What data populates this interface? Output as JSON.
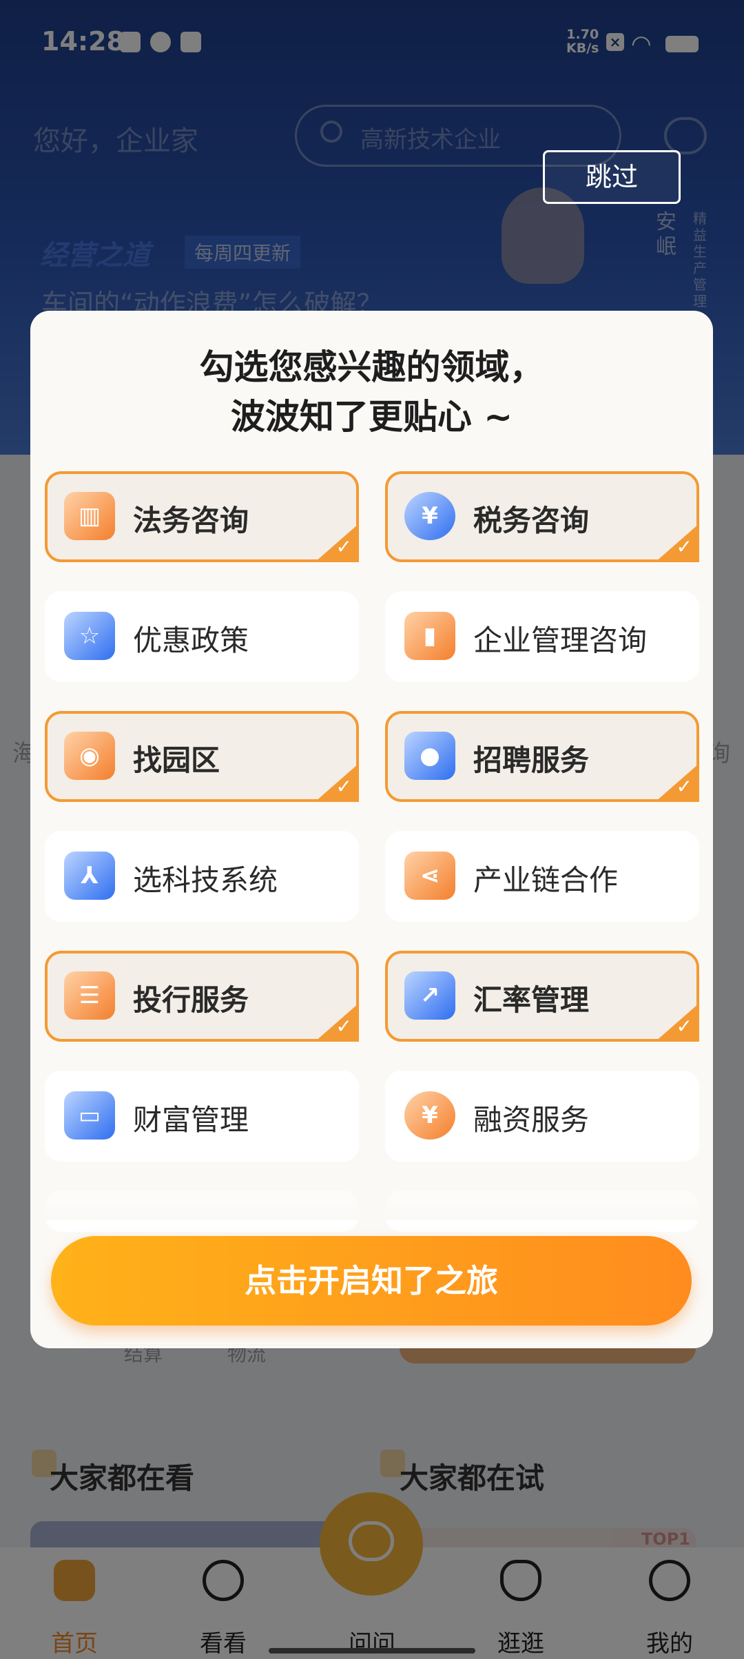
{
  "status_bar": {
    "time": "14:28",
    "speed": "1.70",
    "speed_unit": "KB/s"
  },
  "header": {
    "greeting": "您好，企业家",
    "search_placeholder": "高新技术企业",
    "skip_label": "跳过"
  },
  "banner": {
    "brand": "经营之道",
    "tag": "每周四更新",
    "title": "车间的“动作浪费”怎么破解？",
    "person_name": "安岷",
    "person_role": "精益生产管理"
  },
  "modal": {
    "title_line1": "勾选您感兴趣的领域，",
    "title_line2": "波波知了更贴心 ~",
    "options": [
      {
        "label": "法务咨询",
        "selected": true,
        "icon": "courthouse-icon",
        "color": "orange"
      },
      {
        "label": "税务咨询",
        "selected": true,
        "icon": "yuan-coin-icon",
        "color": "blue"
      },
      {
        "label": "优惠政策",
        "selected": false,
        "icon": "policy-document-icon",
        "color": "blue"
      },
      {
        "label": "企业管理咨询",
        "selected": false,
        "icon": "monitor-chart-icon",
        "color": "orange"
      },
      {
        "label": "找园区",
        "selected": true,
        "icon": "location-pin-icon",
        "color": "orange"
      },
      {
        "label": "招聘服务",
        "selected": true,
        "icon": "person-icon",
        "color": "blue"
      },
      {
        "label": "选科技系统",
        "selected": false,
        "icon": "cube-system-icon",
        "color": "blue"
      },
      {
        "label": "产业链合作",
        "selected": false,
        "icon": "share-folder-icon",
        "color": "orange"
      },
      {
        "label": "投行服务",
        "selected": true,
        "icon": "document-stack-icon",
        "color": "orange"
      },
      {
        "label": "汇率管理",
        "selected": true,
        "icon": "trend-monitor-icon",
        "color": "blue"
      },
      {
        "label": "财富管理",
        "selected": false,
        "icon": "wallet-icon",
        "color": "blue"
      },
      {
        "label": "融资服务",
        "selected": false,
        "icon": "coins-icon",
        "color": "orange"
      }
    ],
    "cta_label": "点击开启知了之旅"
  },
  "background": {
    "side_left": "海",
    "side_right": "询",
    "mid_text_1": "结算",
    "mid_text_2": "物流",
    "section_left": "大家都在看",
    "section_right": "大家都在试",
    "badge": "TOP1"
  },
  "tabbar": {
    "tabs": [
      {
        "label": "首页",
        "active": true
      },
      {
        "label": "看看",
        "active": false
      },
      {
        "label": "问问",
        "active": false
      },
      {
        "label": "逛逛",
        "active": false
      },
      {
        "label": "我的",
        "active": false
      }
    ]
  },
  "colors": {
    "accent": "#f39a34",
    "cta_start": "#ffb219",
    "cta_end": "#ff8c1e",
    "hero_blue": "#2c56b4"
  }
}
